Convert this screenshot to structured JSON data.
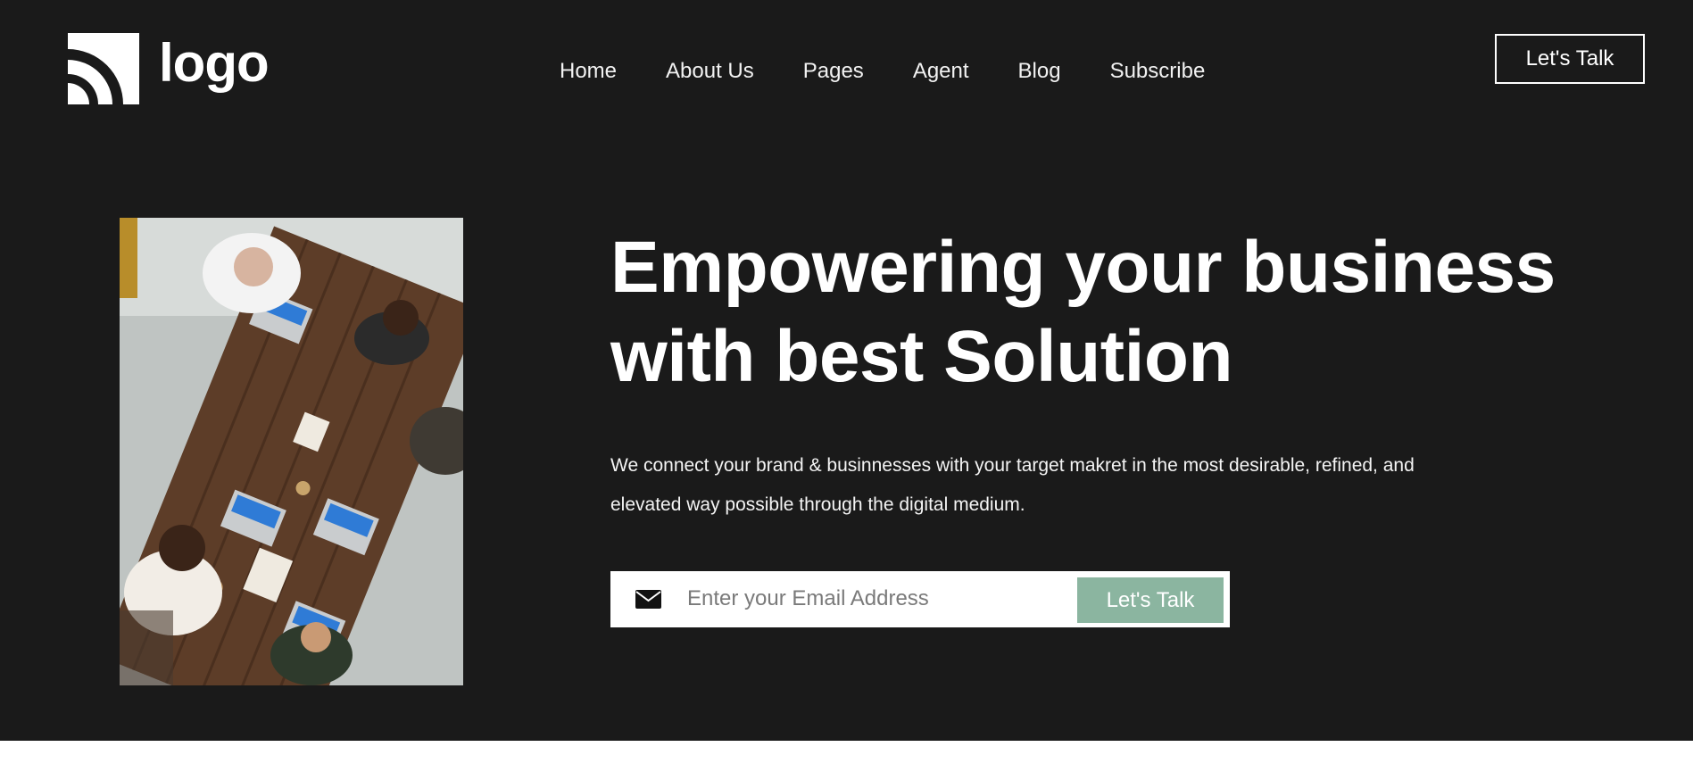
{
  "header": {
    "logo_text": "logo",
    "nav": [
      {
        "label": "Home"
      },
      {
        "label": "About Us"
      },
      {
        "label": "Pages"
      },
      {
        "label": "Agent"
      },
      {
        "label": "Blog"
      },
      {
        "label": "Subscribe"
      }
    ],
    "cta_label": "Let's Talk"
  },
  "hero": {
    "headline_line1": "Empowering your business",
    "headline_line2": "with best Solution",
    "description_line1": "We connect your brand & businnesses with your target makret in the most desirable, refined, and",
    "description_line2": "elevated way possible through the digital medium.",
    "email_placeholder": "Enter your Email Address",
    "email_value": "",
    "submit_label": "Let's Talk",
    "icon": "envelope-icon"
  },
  "colors": {
    "background": "#1a1a1a",
    "accent_button": "#8bb5a0",
    "text": "#ffffff"
  }
}
